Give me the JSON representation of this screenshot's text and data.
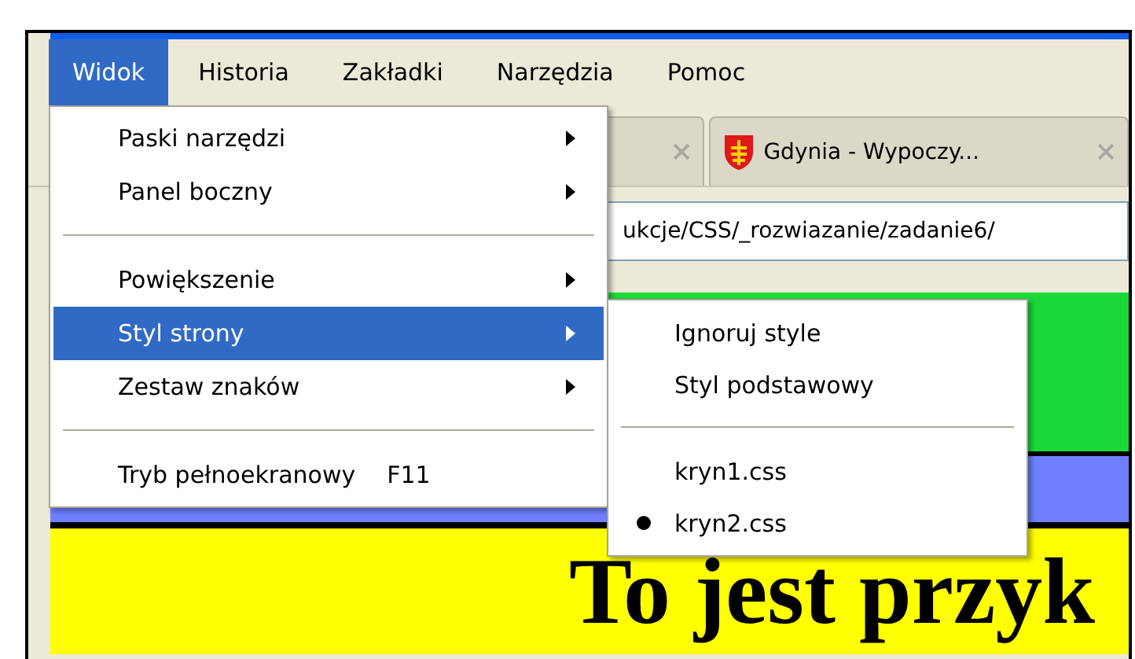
{
  "menu_bar": [
    {
      "label": "Widok",
      "selected": true
    },
    {
      "label": "Historia",
      "selected": false
    },
    {
      "label": "Zakładki",
      "selected": false
    },
    {
      "label": "Narzędzia",
      "selected": false
    },
    {
      "label": "Pomoc",
      "selected": false
    }
  ],
  "tabs": [
    {
      "selected": false
    },
    {
      "title": "Gdynia - Wypoczy...",
      "selected": false
    }
  ],
  "address_bar": {
    "value": "ukcje/CSS/_rozwiazanie/zadanie6/"
  },
  "page": {
    "heading": "To jest przyk"
  },
  "menu": {
    "items": [
      {
        "kind": "item",
        "label": "Paski narzędzi",
        "submenu": true,
        "selected": false
      },
      {
        "kind": "item",
        "label": "Panel boczny",
        "submenu": true,
        "selected": false
      },
      {
        "kind": "separator"
      },
      {
        "kind": "item",
        "label": "Powiększenie",
        "submenu": true,
        "selected": false
      },
      {
        "kind": "item",
        "label": "Styl strony",
        "submenu": true,
        "selected": true
      },
      {
        "kind": "item",
        "label": "Zestaw znaków",
        "submenu": true,
        "selected": false
      },
      {
        "kind": "separator"
      },
      {
        "kind": "item",
        "label": "Tryb pełnoekranowy",
        "shortcut": "F11",
        "submenu": false,
        "selected": false
      }
    ]
  },
  "submenu": {
    "items": [
      {
        "kind": "item",
        "label": "Ignoruj style",
        "checked": false
      },
      {
        "kind": "item",
        "label": "Styl podstawowy",
        "checked": false
      },
      {
        "kind": "separator"
      },
      {
        "kind": "item",
        "label": "kryn1.css",
        "checked": false
      },
      {
        "kind": "item",
        "label": "kryn2.css",
        "checked": true
      }
    ]
  }
}
